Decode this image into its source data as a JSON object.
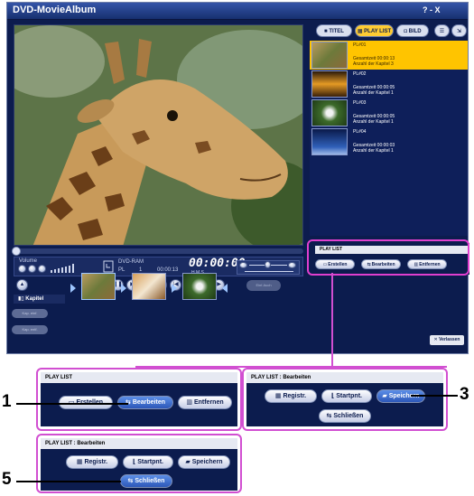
{
  "window": {
    "title": "DVD-MovieAlbum",
    "controls": "?  -  X"
  },
  "tabs": [
    {
      "label": "TITEL",
      "icon": "film-icon"
    },
    {
      "label": "PLAY LIST",
      "icon": "playlist-icon"
    },
    {
      "label": "BILD",
      "icon": "picture-icon"
    }
  ],
  "playlist": {
    "items": [
      {
        "name": "PL#01",
        "total_time": "Gesamtzeit 00:00:13",
        "chapters": "Anzahl der Kapitel  3"
      },
      {
        "name": "PL#02",
        "total_time": "Gesamtzeit 00:00:05",
        "chapters": "Anzahl der Kapitel  1"
      },
      {
        "name": "PL#03",
        "total_time": "Gesamtzeit 00:00:05",
        "chapters": "Anzahl der Kapitel  1"
      },
      {
        "name": "PL#04",
        "total_time": "Gesamtzeit 00:00:03",
        "chapters": "Anzahl der Kapitel  1"
      }
    ]
  },
  "panel": {
    "header": "PLAY LIST",
    "erstellen": "Erstellen",
    "bearbeiten": "Bearbeiten",
    "entfernen": "Entfernen"
  },
  "player": {
    "volume_label": "Volume",
    "disc": "DVD-RAM",
    "mode": "PL",
    "track": "1",
    "elapsed": "00:00:13",
    "lcd_time": "00:00:00",
    "lcd_units": "H     M     S",
    "skip_label": "Einf.Auch"
  },
  "chapter": {
    "label": "Kapitel",
    "btn1": "Kap. einf.",
    "btn2": "Kap. entf."
  },
  "verlassen": "Verlassen",
  "callouts": {
    "c1": {
      "header": "PLAY LIST",
      "erstellen": "Erstellen",
      "bearbeiten": "Bearbeiten",
      "entfernen": "Entfernen",
      "number": "1"
    },
    "c3": {
      "header": "PLAY LIST : Bearbeiten",
      "registr": "Registr.",
      "startpnt": "Startpnt.",
      "speichern": "Speichern",
      "schliessen": "Schließen",
      "number": "3"
    },
    "c5": {
      "header": "PLAY LIST : Bearbeiten",
      "registr": "Registr.",
      "startpnt": "Startpnt.",
      "speichern": "Speichern",
      "schliessen": "Schließen",
      "number": "5"
    }
  },
  "colors": {
    "window_bg": "#0c1c4e",
    "highlight": "#d14fd1",
    "selected_item": "#ffc400"
  }
}
